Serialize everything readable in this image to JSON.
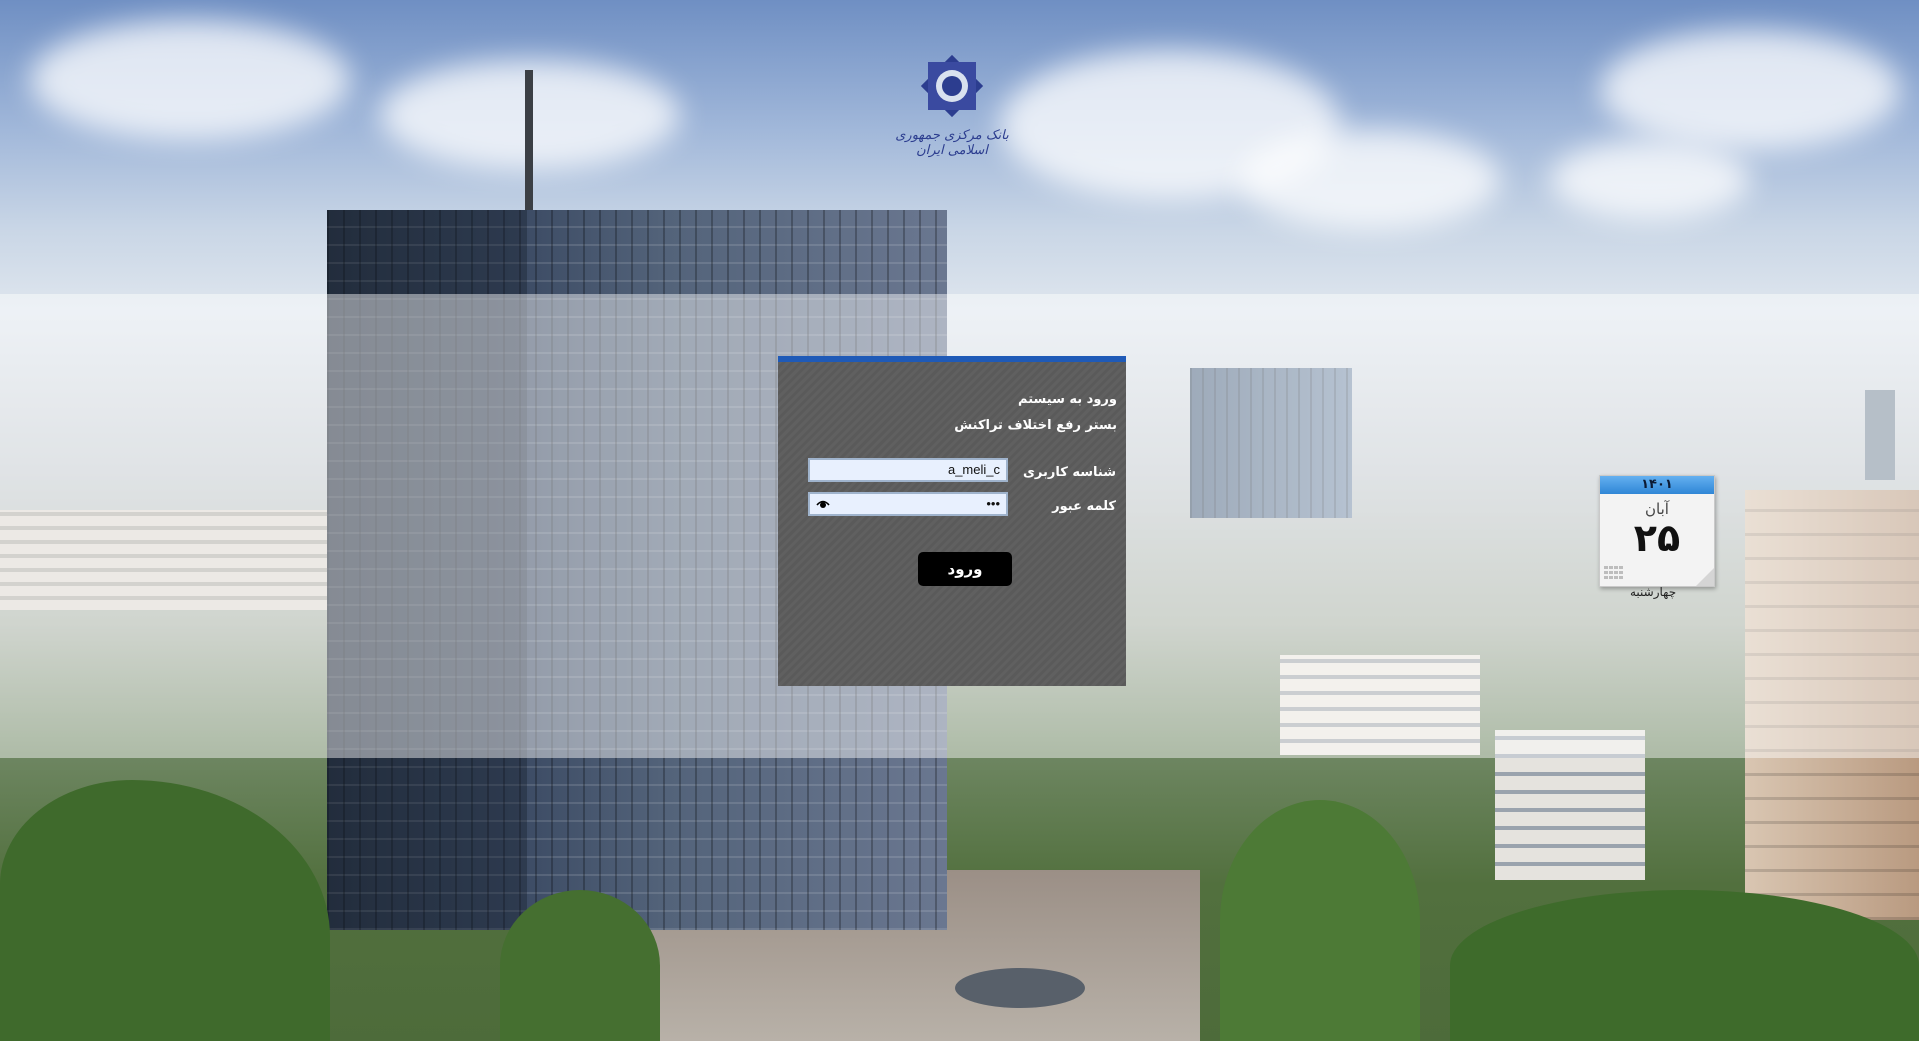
{
  "logo": {
    "name": "central-bank-logo",
    "caption": "بانک مرکزی جمهوری اسلامی ایران"
  },
  "login": {
    "title": "ورود به سیستم",
    "subtitle": "بستر رفع اختلاف تراکنش",
    "username_label": "شناسه کاربری",
    "username_value": "a_meli_c",
    "password_label": "کلمه عبور",
    "password_value": "•••",
    "submit_label": "ورود"
  },
  "calendar": {
    "year": "۱۴۰۱",
    "month": "آبان",
    "day": "۲۵",
    "weekday": "چهارشنبه"
  },
  "colors": {
    "panel_bg": "#5a5a5a",
    "panel_accent": "#1f5ab7",
    "button_bg": "#000000",
    "input_bg": "#e8f0fe",
    "calendar_header": "#2f86d6"
  }
}
